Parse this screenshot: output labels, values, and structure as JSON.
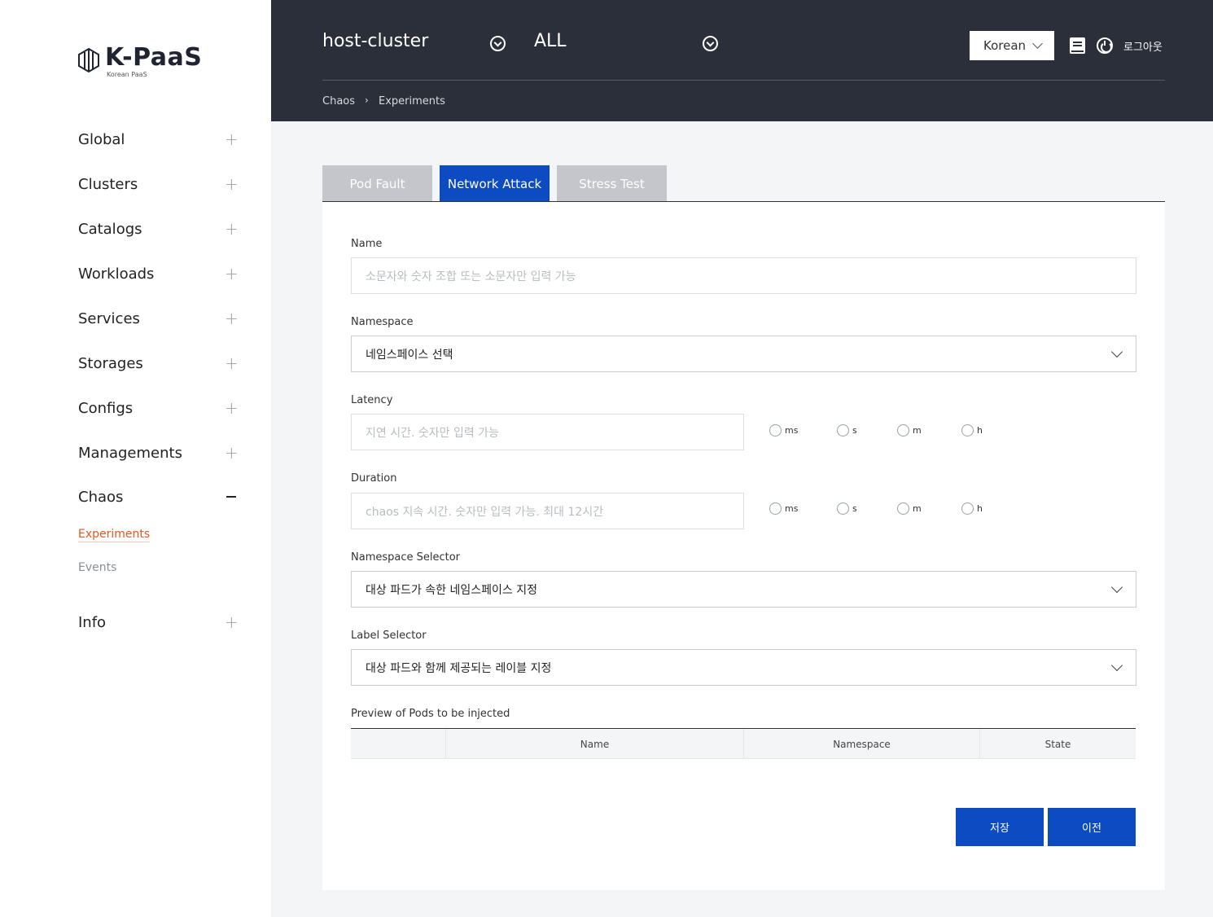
{
  "brand": {
    "name": "K-PaaS",
    "subtitle": "Korean PaaS"
  },
  "sidebar": {
    "items": [
      {
        "label": "Global"
      },
      {
        "label": "Clusters"
      },
      {
        "label": "Catalogs"
      },
      {
        "label": "Workloads"
      },
      {
        "label": "Services"
      },
      {
        "label": "Storages"
      },
      {
        "label": "Configs"
      },
      {
        "label": "Managements"
      },
      {
        "label": "Chaos",
        "expanded": true
      },
      {
        "label": "Info"
      }
    ],
    "chaos_sub": [
      {
        "label": "Experiments",
        "active": true
      },
      {
        "label": "Events",
        "active": false
      }
    ]
  },
  "header": {
    "cluster": "host-cluster",
    "namespace": "ALL",
    "language": "Korean",
    "logout": "로그아웃",
    "breadcrumb": [
      "Chaos",
      "Experiments"
    ]
  },
  "tabs": [
    {
      "label": "Pod Fault",
      "active": false
    },
    {
      "label": "Network Attack",
      "active": true
    },
    {
      "label": "Stress Test",
      "active": false
    }
  ],
  "form": {
    "name": {
      "label": "Name",
      "placeholder": "소문자와 숫자 조합 또는 소문자만 입력 가능"
    },
    "namespace": {
      "label": "Namespace",
      "value": "네임스페이스 선택"
    },
    "latency": {
      "label": "Latency",
      "placeholder": "지연 시간. 숫자만 입력 가능",
      "units": [
        "ms",
        "s",
        "m",
        "h"
      ]
    },
    "duration": {
      "label": "Duration",
      "placeholder": "chaos 지속 시간. 숫자만 입력 가능. 최대 12시간",
      "units": [
        "ms",
        "s",
        "m",
        "h"
      ]
    },
    "namespace_selector": {
      "label": "Namespace Selector",
      "value": "대상 파드가 속한 네임스페이스 지정"
    },
    "label_selector": {
      "label": "Label Selector",
      "value": "대상 파드와 함께 제공되는 레이블 지정"
    },
    "preview": {
      "label": "Preview of Pods to be injected",
      "columns": [
        "",
        "Name",
        "Namespace",
        "State"
      ]
    }
  },
  "buttons": {
    "save": "저장",
    "prev": "이전"
  },
  "colors": {
    "primary": "#0d4bc3",
    "header_bg": "#2b2f3a",
    "active_link": "#e2571f"
  }
}
